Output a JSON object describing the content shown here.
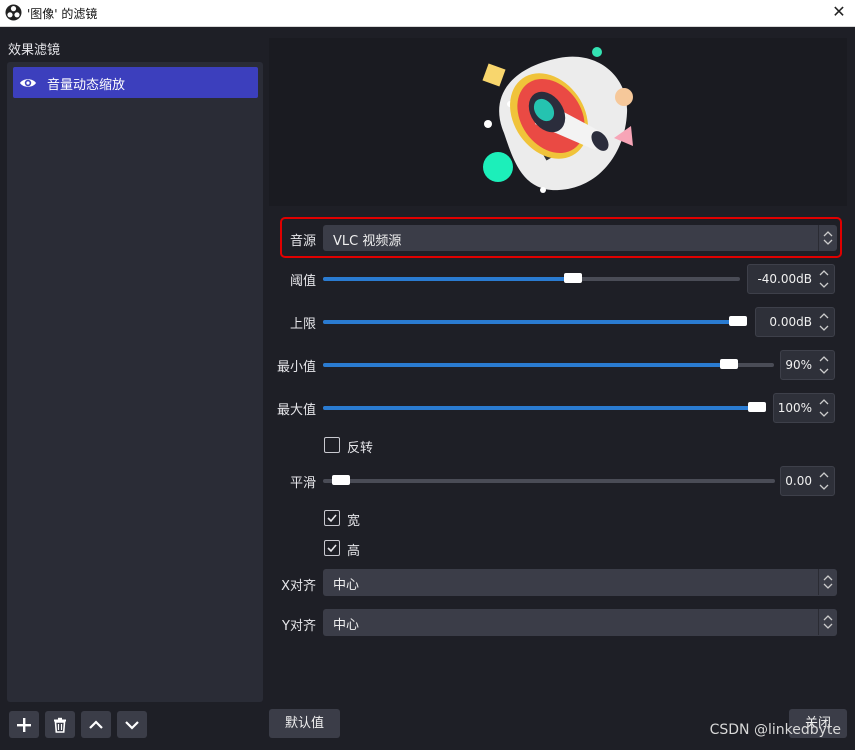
{
  "window": {
    "title": "'图像' 的滤镜",
    "app_icon": "obs-logo-icon",
    "close_icon": "close-icon"
  },
  "filters": {
    "heading": "效果滤镜",
    "items": [
      {
        "label": "音量动态缩放",
        "visible_icon": "eye-icon",
        "selected": true
      }
    ],
    "toolbar_icons": [
      "plus-icon",
      "trash-icon",
      "chevron-up-icon",
      "chevron-down-icon"
    ]
  },
  "properties": {
    "audio_source": {
      "label": "音源",
      "value": "VLC 视频源"
    },
    "threshold": {
      "label": "阈值",
      "value": "-40.00dB",
      "fraction": 0.6
    },
    "upper_limit": {
      "label": "上限",
      "value": "0.00dB",
      "fraction": 1.0
    },
    "min_value": {
      "label": "最小值",
      "value": "90%",
      "fraction": 0.9
    },
    "max_value": {
      "label": "最大值",
      "value": "100%",
      "fraction": 1.0
    },
    "invert": {
      "label": "反转",
      "checked": false
    },
    "smooth": {
      "label": "平滑",
      "value": "0.00",
      "fraction": 0.0
    },
    "width": {
      "label": "宽",
      "checked": true
    },
    "height": {
      "label": "高",
      "checked": true
    },
    "x_align": {
      "label": "X对齐",
      "value": "中心"
    },
    "y_align": {
      "label": "Y对齐",
      "value": "中心"
    }
  },
  "buttons": {
    "defaults": "默认值",
    "close": "关闭"
  },
  "watermark": "CSDN @linkedbyte",
  "colors": {
    "selection": "#3c3fbd",
    "slider_fill": "#2a7bd1",
    "highlight": "#e00000"
  }
}
